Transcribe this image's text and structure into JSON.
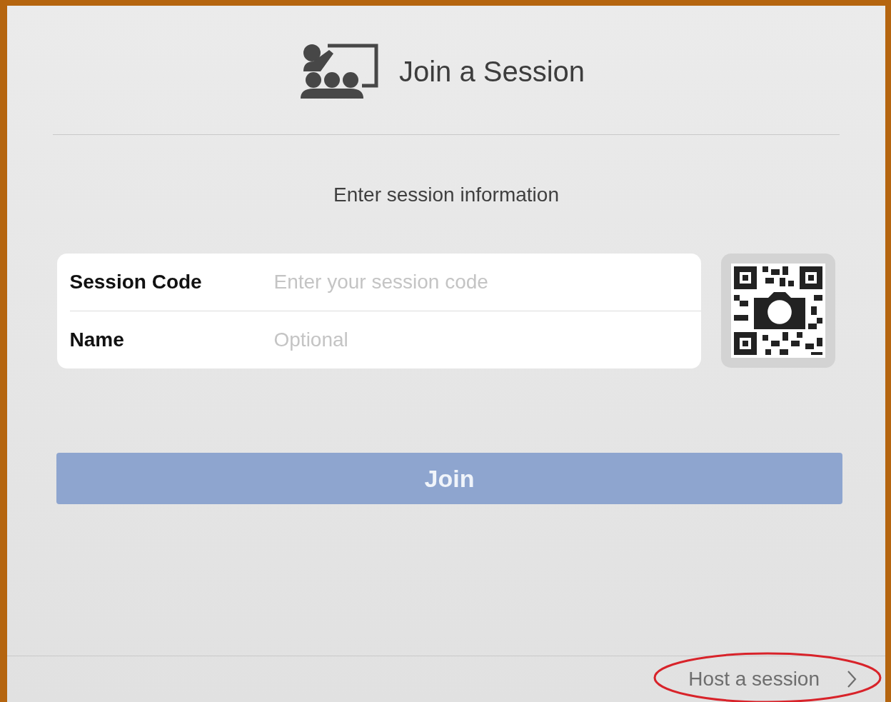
{
  "header": {
    "title": "Join a Session"
  },
  "instructions": "Enter session information",
  "fields": [
    {
      "label": "Session Code",
      "placeholder": "Enter your session code"
    },
    {
      "label": "Name",
      "placeholder": "Optional"
    }
  ],
  "join_button": {
    "label": "Join",
    "disabled": true
  },
  "footer": {
    "link": "Host a session",
    "circled": true
  }
}
